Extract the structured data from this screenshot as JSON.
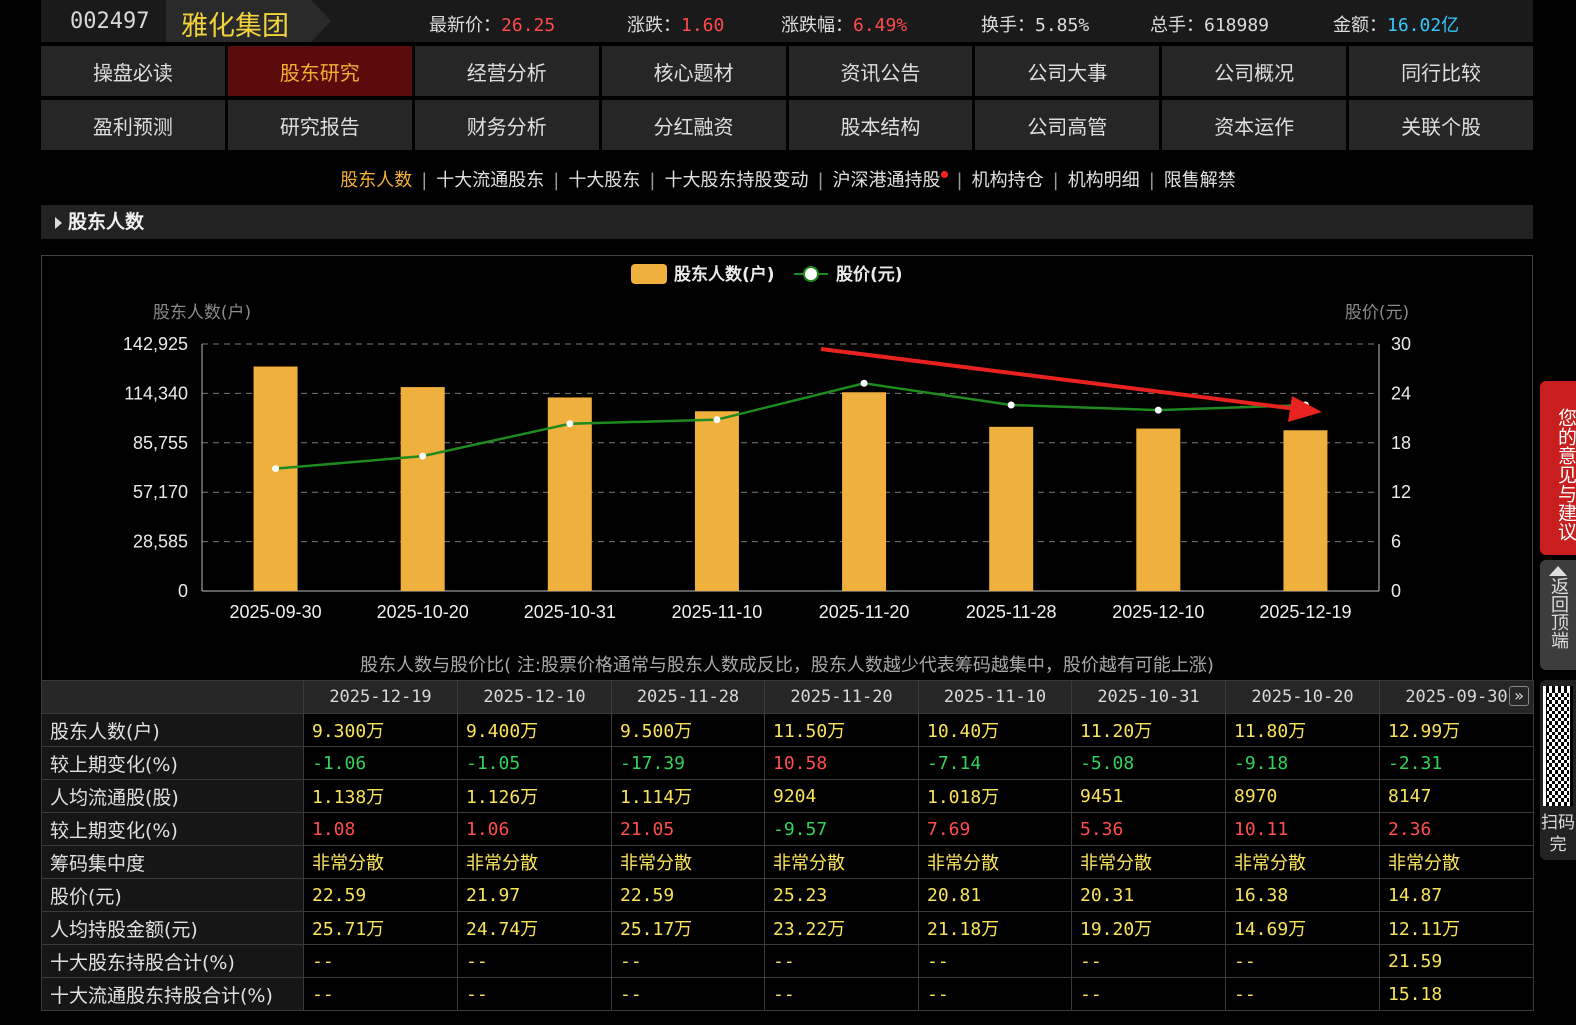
{
  "header": {
    "code": "002497",
    "name": "雅化集团",
    "quotes": [
      {
        "label": "最新价：",
        "value": "26.25",
        "cls": "v"
      },
      {
        "label": "涨跌：",
        "value": "1.60",
        "cls": "v"
      },
      {
        "label": "涨跌幅：",
        "value": "6.49%",
        "cls": "v"
      },
      {
        "label": "换手：",
        "value": "5.85%",
        "cls": ""
      },
      {
        "label": "总手：",
        "value": "618989",
        "cls": ""
      },
      {
        "label": "金额：",
        "value": "16.02亿",
        "cls": "amt"
      }
    ]
  },
  "nav_row1": [
    "操盘必读",
    "股东研究",
    "经营分析",
    "核心题材",
    "资讯公告",
    "公司大事",
    "公司概况",
    "同行比较"
  ],
  "nav_row2": [
    "盈利预测",
    "研究报告",
    "财务分析",
    "分红融资",
    "股本结构",
    "公司高管",
    "资本运作",
    "关联个股"
  ],
  "nav_active": "股东研究",
  "subnav": [
    "股东人数",
    "十大流通股东",
    "十大股东",
    "十大股东持股变动",
    "沪深港通持股",
    "机构持仓",
    "机构明细",
    "限售解禁"
  ],
  "subnav_active": "股东人数",
  "subnav_dot_item": "沪深港通持股",
  "section_title": "股东人数",
  "chart_note": "股东人数与股价比( 注:股票价格通常与股东人数成反比，股东人数越少代表筹码越集中，股价越有可能上涨)",
  "chart_data": {
    "type": "bar",
    "categories": [
      "2025-09-30",
      "2025-10-20",
      "2025-10-31",
      "2025-11-10",
      "2025-11-20",
      "2025-11-28",
      "2025-12-10",
      "2025-12-19"
    ],
    "series": [
      {
        "name": "股东人数(户)",
        "type": "bar",
        "axis": "left",
        "values": [
          129900,
          118000,
          112000,
          104000,
          115000,
          95000,
          94000,
          93000
        ],
        "color": "#efb03e"
      },
      {
        "name": "股价(元)",
        "type": "line",
        "axis": "right",
        "values": [
          14.87,
          16.38,
          20.31,
          20.81,
          25.23,
          22.59,
          21.97,
          22.59
        ],
        "color": "#1f8a1f"
      }
    ],
    "ylabel": "股东人数(户)",
    "y2label": "股价(元)",
    "yticks": [
      "0",
      "28,585",
      "57,170",
      "85,755",
      "114,340",
      "142,925"
    ],
    "ylim": [
      0,
      142925
    ],
    "y2ticks": [
      "0",
      "6",
      "12",
      "18",
      "24",
      "30"
    ],
    "y2lim": [
      0,
      30
    ],
    "legend_position": "top-center",
    "grid": true,
    "annotation": "red arrow pointing down-right across recent bars"
  },
  "table": {
    "dates": [
      "2025-12-19",
      "2025-12-10",
      "2025-11-28",
      "2025-11-20",
      "2025-11-10",
      "2025-10-31",
      "2025-10-20",
      "2025-09-30"
    ],
    "rows": [
      {
        "label": "股东人数(户)",
        "cls": "yellow",
        "values": [
          "9.300万",
          "9.400万",
          "9.500万",
          "11.50万",
          "10.40万",
          "11.20万",
          "11.80万",
          "12.99万"
        ]
      },
      {
        "label": "较上期变化(%)",
        "cls": "auto",
        "values": [
          "-1.06",
          "-1.05",
          "-17.39",
          "10.58",
          "-7.14",
          "-5.08",
          "-9.18",
          "-2.31"
        ]
      },
      {
        "label": "人均流通股(股)",
        "cls": "yellow",
        "values": [
          "1.138万",
          "1.126万",
          "1.114万",
          "9204",
          "1.018万",
          "9451",
          "8970",
          "8147"
        ]
      },
      {
        "label": "较上期变化(%)",
        "cls": "auto",
        "values": [
          "1.08",
          "1.06",
          "21.05",
          "-9.57",
          "7.69",
          "5.36",
          "10.11",
          "2.36"
        ]
      },
      {
        "label": "筹码集中度",
        "cls": "yellow",
        "values": [
          "非常分散",
          "非常分散",
          "非常分散",
          "非常分散",
          "非常分散",
          "非常分散",
          "非常分散",
          "非常分散"
        ]
      },
      {
        "label": "股价(元)",
        "cls": "yellow",
        "values": [
          "22.59",
          "21.97",
          "22.59",
          "25.23",
          "20.81",
          "20.31",
          "16.38",
          "14.87"
        ]
      },
      {
        "label": "人均持股金额(元)",
        "cls": "yellow",
        "values": [
          "25.71万",
          "24.74万",
          "25.17万",
          "23.22万",
          "21.18万",
          "19.20万",
          "14.69万",
          "12.11万"
        ]
      },
      {
        "label": "十大股东持股合计(%)",
        "cls": "yellow",
        "values": [
          "--",
          "--",
          "--",
          "--",
          "--",
          "--",
          "--",
          "21.59"
        ]
      },
      {
        "label": "十大流通股东持股合计(%)",
        "cls": "yellow",
        "values": [
          "--",
          "--",
          "--",
          "--",
          "--",
          "--",
          "--",
          "15.18"
        ]
      }
    ]
  },
  "side": {
    "feedback": "您的意见与建议",
    "back_top": "返回顶端",
    "qr_text": "扫码完"
  }
}
